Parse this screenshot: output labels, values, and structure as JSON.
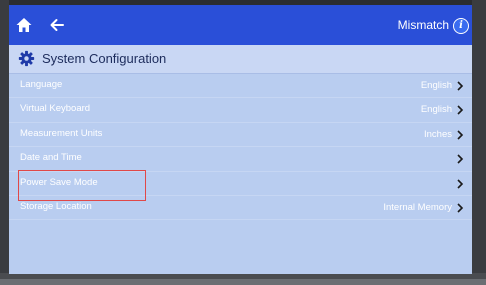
{
  "topbar": {
    "status_text": "Mismatch",
    "info_glyph": "i",
    "icons": [
      "home-icon",
      "back-arrow-icon",
      "info-icon"
    ]
  },
  "titlebar": {
    "title": "System Configuration",
    "icon": "gear-icon"
  },
  "settings": [
    {
      "label": "Language",
      "value": "English"
    },
    {
      "label": "Virtual Keyboard",
      "value": "English"
    },
    {
      "label": "Measurement Units",
      "value": "Inches"
    },
    {
      "label": "Date and Time",
      "value": ""
    },
    {
      "label": "Power Save Mode",
      "value": ""
    },
    {
      "label": "Storage Location",
      "value": "Internal Memory"
    }
  ],
  "colors": {
    "topbar": "#2a4fd8",
    "screen_bg": "#b9cdf0",
    "highlight_box": "#e04848"
  }
}
